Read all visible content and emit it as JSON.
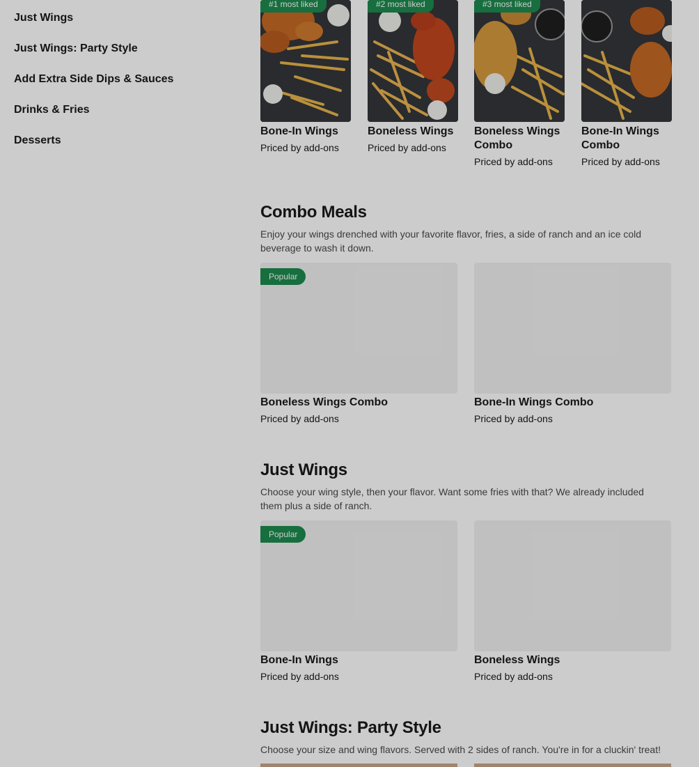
{
  "sidebar": {
    "items": [
      {
        "label": "Just Wings"
      },
      {
        "label": "Just Wings: Party Style"
      },
      {
        "label": "Add Extra Side Dips & Sauces"
      },
      {
        "label": "Drinks & Fries"
      },
      {
        "label": "Desserts"
      }
    ]
  },
  "carousel": {
    "items": [
      {
        "badge": "#1 most liked",
        "title": "Bone-In Wings",
        "price": "Priced by add-ons"
      },
      {
        "badge": "#2 most liked",
        "title": "Boneless Wings",
        "price": "Priced by add-ons"
      },
      {
        "badge": "#3 most liked",
        "title": "Boneless Wings Combo",
        "price": "Priced by add-ons"
      },
      {
        "badge": "",
        "title": "Bone-In Wings Combo",
        "price": "Priced by add-ons"
      }
    ]
  },
  "sections": [
    {
      "title": "Combo Meals",
      "description": "Enjoy your wings drenched with your favorite flavor, fries, a side of ranch and an ice cold beverage to wash it down.",
      "items": [
        {
          "badge": "Popular",
          "title": "Boneless Wings Combo",
          "price": "Priced by add-ons"
        },
        {
          "badge": "",
          "title": "Bone-In Wings Combo",
          "price": "Priced by add-ons"
        }
      ]
    },
    {
      "title": "Just Wings",
      "description": "Choose your wing style, then your flavor. Want some fries with that? We already included them plus a side of ranch.",
      "items": [
        {
          "badge": "Popular",
          "title": "Bone-In Wings",
          "price": "Priced by add-ons"
        },
        {
          "badge": "",
          "title": "Boneless Wings",
          "price": "Priced by add-ons"
        }
      ]
    },
    {
      "title": "Just Wings: Party Style",
      "description": "Choose your size and wing flavors. Served with 2 sides of ranch. You're in for a cluckin' treat!"
    }
  ],
  "colors": {
    "badge": "#1d8a4e",
    "overlay": "rgba(0,0,0,0.2)"
  }
}
